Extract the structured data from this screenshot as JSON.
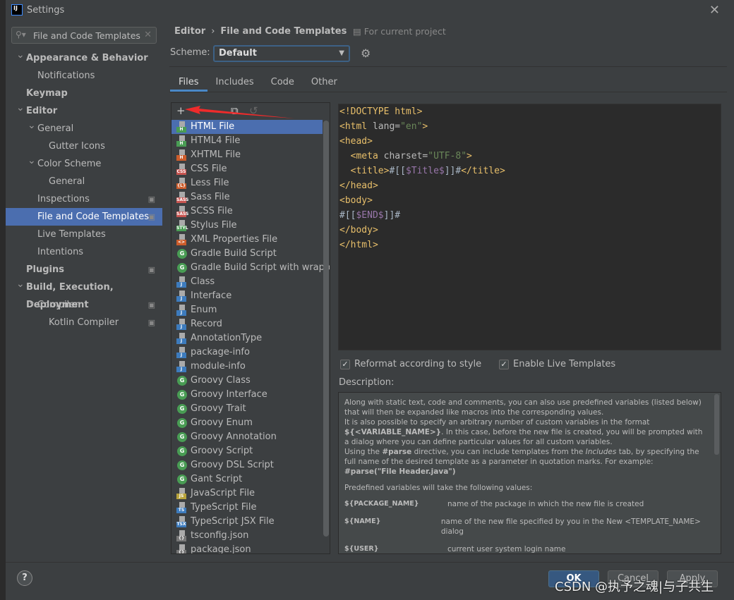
{
  "window": {
    "title": "Settings",
    "close": "✕"
  },
  "search": {
    "value": "File and Code Templates",
    "clear": "✕"
  },
  "sidebar": {
    "items": [
      {
        "label": "Appearance & Behavior",
        "level": 0,
        "expanded": true,
        "bold": true
      },
      {
        "label": "Notifications",
        "level": 1
      },
      {
        "label": "Keymap",
        "level": 0,
        "bold": true
      },
      {
        "label": "Editor",
        "level": 0,
        "expanded": true,
        "bold": true
      },
      {
        "label": "General",
        "level": 1,
        "expanded": true
      },
      {
        "label": "Gutter Icons",
        "level": 2
      },
      {
        "label": "Color Scheme",
        "level": 1,
        "expanded": true
      },
      {
        "label": "General",
        "level": 2
      },
      {
        "label": "Inspections",
        "level": 1,
        "project": true
      },
      {
        "label": "File and Code Templates",
        "level": 1,
        "selected": true,
        "project": true
      },
      {
        "label": "Live Templates",
        "level": 1
      },
      {
        "label": "Intentions",
        "level": 1
      },
      {
        "label": "Plugins",
        "level": 0,
        "bold": true,
        "project": true
      },
      {
        "label": "Build, Execution, Deployment",
        "level": 0,
        "expanded": true,
        "bold": true
      },
      {
        "label": "Compiler",
        "level": 1,
        "expanded": true,
        "project": true
      },
      {
        "label": "Kotlin Compiler",
        "level": 2,
        "project": true
      }
    ]
  },
  "header": {
    "breadcrumb": [
      "Editor",
      "File and Code Templates"
    ],
    "scope": "For current project"
  },
  "scheme": {
    "label": "Scheme:",
    "value": "Default"
  },
  "tabs": [
    {
      "label": "Files",
      "active": true
    },
    {
      "label": "Includes"
    },
    {
      "label": "Code"
    },
    {
      "label": "Other"
    }
  ],
  "toolbar": {
    "add": "+",
    "remove": "−",
    "copy": "⧉",
    "reset": "↺"
  },
  "files": [
    {
      "label": "HTML File",
      "badge": "H",
      "color": "#499c54",
      "selected": true
    },
    {
      "label": "HTML4 File",
      "badge": "H",
      "color": "#499c54"
    },
    {
      "label": "XHTML File",
      "badge": "H",
      "color": "#cc5c2b"
    },
    {
      "label": "CSS File",
      "badge": "CSS",
      "color": "#c75450"
    },
    {
      "label": "Less File",
      "badge": "{L}",
      "color": "#cc5c2b"
    },
    {
      "label": "Sass File",
      "badge": "SASS",
      "color": "#c75450"
    },
    {
      "label": "SCSS File",
      "badge": "SASS",
      "color": "#c75450"
    },
    {
      "label": "Stylus File",
      "badge": "STYL",
      "color": "#499c54"
    },
    {
      "label": "XML Properties File",
      "badge": "<>",
      "color": "#cc5c2b"
    },
    {
      "label": "Gradle Build Script",
      "badge": "G",
      "kind": "circle"
    },
    {
      "label": "Gradle Build Script with wrapper",
      "badge": "G",
      "kind": "circle"
    },
    {
      "label": "Class",
      "badge": "J",
      "color": "#3d7bbd"
    },
    {
      "label": "Interface",
      "badge": "J",
      "color": "#3d7bbd"
    },
    {
      "label": "Enum",
      "badge": "J",
      "color": "#3d7bbd"
    },
    {
      "label": "Record",
      "badge": "J",
      "color": "#3d7bbd"
    },
    {
      "label": "AnnotationType",
      "badge": "J",
      "color": "#3d7bbd"
    },
    {
      "label": "package-info",
      "badge": "J",
      "color": "#3d7bbd"
    },
    {
      "label": "module-info",
      "badge": "J",
      "color": "#3d7bbd"
    },
    {
      "label": "Groovy Class",
      "badge": "G",
      "kind": "circle"
    },
    {
      "label": "Groovy Interface",
      "badge": "G",
      "kind": "circle"
    },
    {
      "label": "Groovy Trait",
      "badge": "G",
      "kind": "circle"
    },
    {
      "label": "Groovy Enum",
      "badge": "G",
      "kind": "circle"
    },
    {
      "label": "Groovy Annotation",
      "badge": "G",
      "kind": "circle"
    },
    {
      "label": "Groovy Script",
      "badge": "G",
      "kind": "circle"
    },
    {
      "label": "Groovy DSL Script",
      "badge": "G",
      "kind": "circle"
    },
    {
      "label": "Gant Script",
      "badge": "G",
      "kind": "circle"
    },
    {
      "label": "JavaScript File",
      "badge": "JS",
      "color": "#b8a33b"
    },
    {
      "label": "TypeScript File",
      "badge": "TS",
      "color": "#3d7bbd"
    },
    {
      "label": "TypeScript JSX File",
      "badge": "TSX",
      "color": "#3d7bbd"
    },
    {
      "label": "tsconfig.json",
      "badge": "{}",
      "color": "#777"
    },
    {
      "label": "package.json",
      "badge": "{}",
      "color": "#777"
    }
  ],
  "code": [
    [
      [
        "tg",
        "<!DOCTYPE html>"
      ]
    ],
    [
      [
        "tg",
        "<html "
      ],
      [
        "at",
        "lang="
      ],
      [
        "av",
        "\"en\""
      ],
      [
        "tg",
        ">"
      ]
    ],
    [
      [
        "tg",
        "<head>"
      ]
    ],
    [
      [
        "tx",
        "  "
      ],
      [
        "tg",
        "<meta "
      ],
      [
        "at",
        "charset="
      ],
      [
        "av",
        "\"UTF-8\""
      ],
      [
        "tg",
        ">"
      ]
    ],
    [
      [
        "tx",
        "  "
      ],
      [
        "tg",
        "<title>"
      ],
      [
        "tx",
        "#[["
      ],
      [
        "vr",
        "$Title$"
      ],
      [
        "tx",
        "]]#"
      ],
      [
        "tg",
        "</title>"
      ]
    ],
    [
      [
        "tg",
        "</head>"
      ]
    ],
    [
      [
        "tg",
        "<body>"
      ]
    ],
    [
      [
        "tx",
        "#[["
      ],
      [
        "vr",
        "$END$"
      ],
      [
        "tx",
        "]]#"
      ]
    ],
    [
      [
        "tg",
        "</body>"
      ]
    ],
    [
      [
        "tg",
        "</html>"
      ]
    ]
  ],
  "options": {
    "reformat": {
      "label": "Reformat according to style",
      "checked": true
    },
    "live": {
      "label": "Enable Live Templates",
      "checked": true
    }
  },
  "description": {
    "label": "Description:",
    "p1": "Along with static text, code and comments, you can also use predefined variables (listed below) that will then be expanded like macros into the corresponding values.",
    "p2a": "It is also possible to specify an arbitrary number of custom variables in the format ",
    "p2b": "${<VARIABLE_NAME>}",
    "p2c": ". In this case, before the new file is created, you will be prompted with a dialog where you can define particular values for all custom variables.",
    "p3a": "Using the ",
    "p3b": "#parse",
    "p3c": " directive, you can include templates from the ",
    "p3d": "Includes",
    "p3e": " tab, by specifying the full name of the desired template as a parameter in quotation marks. For example:",
    "p3f": "#parse(\"File Header.java\")",
    "p4": "Predefined variables will take the following values:",
    "vars": [
      {
        "k": "${PACKAGE_NAME}",
        "v": "name of the package in which the new file is created"
      },
      {
        "k": "${NAME}",
        "v": "name of the new file specified by you in the New <TEMPLATE_NAME> dialog"
      },
      {
        "k": "${USER}",
        "v": "current user system login name"
      }
    ]
  },
  "buttons": {
    "help": "?",
    "ok": "OK",
    "cancel": "Cancel",
    "apply": "Apply"
  },
  "watermark": "CSDN @执予之魂|与子共生"
}
